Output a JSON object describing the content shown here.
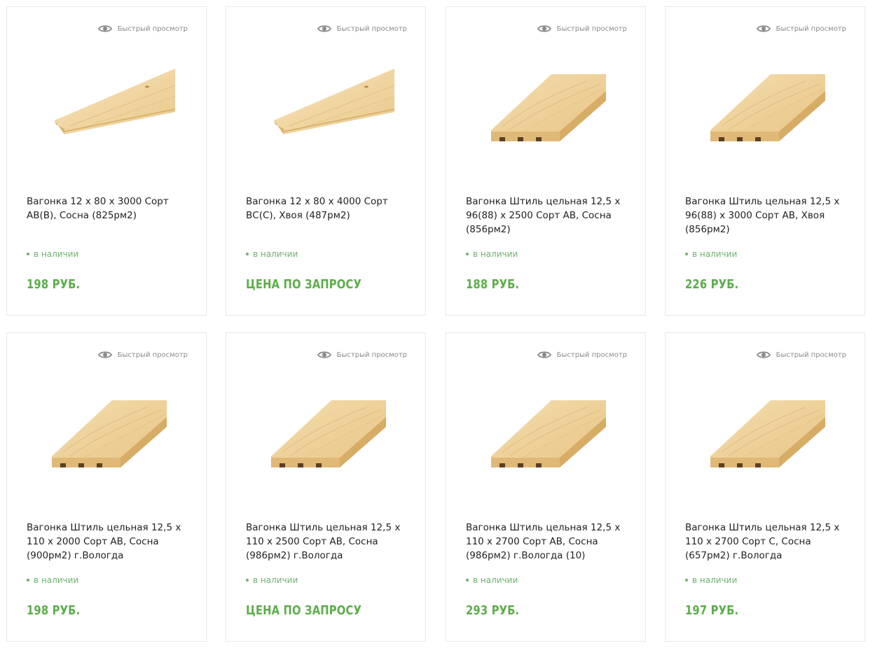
{
  "products": [
    {
      "quick_view": "Быстрый просмотр",
      "title": "Вагонка 12 х 80 х 3000 Сорт АВ(В), Сосна (825рм2)",
      "stock": "в наличии",
      "price": "198 РУБ.",
      "image": "wood-panel-thin"
    },
    {
      "quick_view": "Быстрый просмотр",
      "title": "Вагонка 12 х 80 х 4000 Сорт ВС(С), Хвоя (487рм2)",
      "stock": "в наличии",
      "price": "ЦЕНА ПО ЗАПРОСУ",
      "image": "wood-panel-thin"
    },
    {
      "quick_view": "Быстрый просмотр",
      "title": "Вагонка Штиль цельная 12,5 х 96(88) х 2500 Сорт АВ, Сосна (856рм2)",
      "stock": "в наличии",
      "price": "188 РУБ.",
      "image": "wood-panel-wide"
    },
    {
      "quick_view": "Быстрый просмотр",
      "title": "Вагонка Штиль цельная 12,5 х 96(88) х 3000 Сорт АВ, Хвоя (856рм2)",
      "stock": "в наличии",
      "price": "226 РУБ.",
      "image": "wood-panel-wide"
    },
    {
      "quick_view": "Быстрый просмотр",
      "title": "Вагонка Штиль цельная 12,5 х 110 х 2000 Сорт АВ, Сосна (900рм2) г.Вологда",
      "stock": "в наличии",
      "price": "198 РУБ.",
      "image": "wood-panel-wide"
    },
    {
      "quick_view": "Быстрый просмотр",
      "title": "Вагонка Штиль цельная 12,5 х 110 х 2500 Сорт АВ, Сосна (986рм2) г.Вологда",
      "stock": "в наличии",
      "price": "ЦЕНА ПО ЗАПРОСУ",
      "image": "wood-panel-wide"
    },
    {
      "quick_view": "Быстрый просмотр",
      "title": "Вагонка Штиль цельная 12,5 х 110 х 2700 Сорт АВ, Сосна (986рм2) г.Вологда (10)",
      "stock": "в наличии",
      "price": "293 РУБ.",
      "image": "wood-panel-wide"
    },
    {
      "quick_view": "Быстрый просмотр",
      "title": "Вагонка Штиль цельная 12,5 х 110 х 2700 Сорт С, Сосна (657рм2) г.Вологда",
      "stock": "в наличии",
      "price": "197 РУБ.",
      "image": "wood-panel-wide"
    }
  ],
  "colors": {
    "price": "#5cad4a",
    "stock": "#6fb06f",
    "border": "#e8e8e8",
    "quick_view": "#8a8a8a"
  }
}
